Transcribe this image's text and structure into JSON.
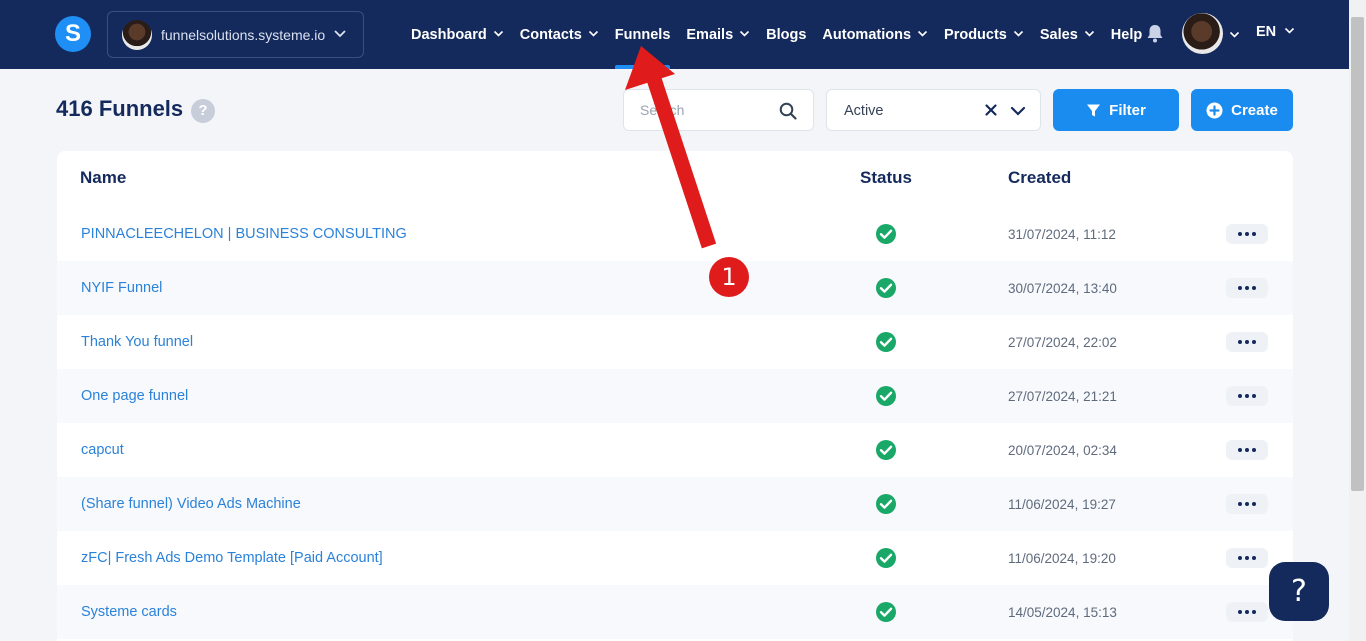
{
  "header": {
    "logo_letter": "S",
    "workspace_name": "funnelsolutions.systeme.io",
    "nav": [
      {
        "label": "Dashboard"
      },
      {
        "label": "Contacts"
      },
      {
        "label": "Funnels"
      },
      {
        "label": "Emails"
      },
      {
        "label": "Blogs"
      },
      {
        "label": "Automations"
      },
      {
        "label": "Products"
      },
      {
        "label": "Sales"
      },
      {
        "label": "Help"
      }
    ],
    "language": "EN"
  },
  "page": {
    "title": "416 Funnels",
    "help_glyph": "?"
  },
  "toolbar": {
    "search_placeholder": "Search",
    "status_value": "Active",
    "filter_label": "Filter",
    "create_label": "Create"
  },
  "table": {
    "columns": {
      "name": "Name",
      "status": "Status",
      "created": "Created"
    },
    "rows": [
      {
        "name": "PINNACLEECHELON | BUSINESS CONSULTING",
        "status": "active",
        "created": "31/07/2024, 11:12"
      },
      {
        "name": "NYIF Funnel",
        "status": "active",
        "created": "30/07/2024, 13:40"
      },
      {
        "name": "Thank You funnel",
        "status": "active",
        "created": "27/07/2024, 22:02"
      },
      {
        "name": "One page funnel",
        "status": "active",
        "created": "27/07/2024, 21:21"
      },
      {
        "name": "capcut",
        "status": "active",
        "created": "20/07/2024, 02:34"
      },
      {
        "name": "(Share funnel) Video Ads Machine",
        "status": "active",
        "created": "11/06/2024, 19:27"
      },
      {
        "name": "zFC| Fresh Ads Demo Template [Paid Account]",
        "status": "active",
        "created": "11/06/2024, 19:20"
      },
      {
        "name": "Systeme cards",
        "status": "active",
        "created": "14/05/2024, 15:13"
      }
    ]
  },
  "annotation": {
    "step_number": "1"
  },
  "support": {
    "glyph": "?"
  },
  "colors": {
    "navbar": "#152a5c",
    "primary": "#1a8cf0",
    "link": "#2b82d9",
    "status_ok": "#1aa868",
    "annotation": "#e01b1b"
  },
  "icons": [
    "logo-icon",
    "chevron-down-icon",
    "bell-icon",
    "search-icon",
    "close-icon",
    "filter-icon",
    "plus-circle-icon",
    "check-circle-icon",
    "more-icon",
    "help-icon",
    "arrow-icon"
  ]
}
